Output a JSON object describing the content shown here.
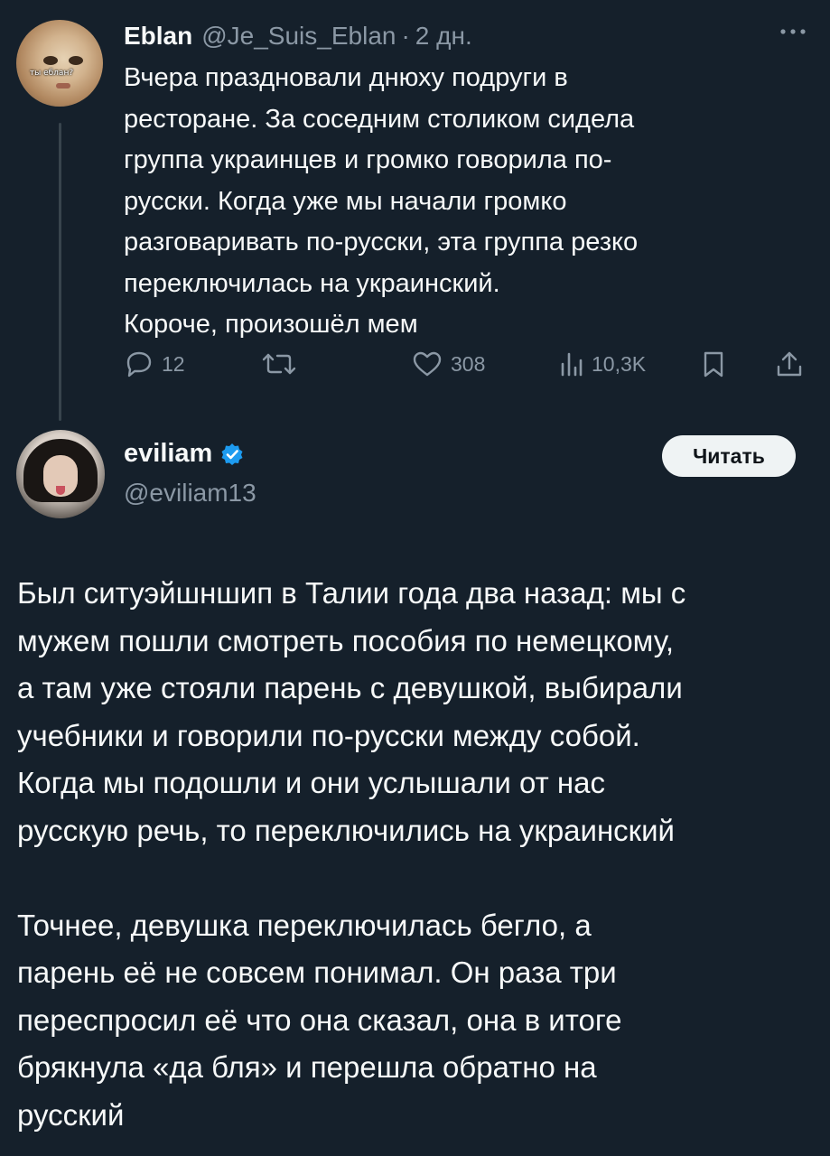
{
  "parent_tweet": {
    "author_name": "Eblan",
    "handle": "@Je_Suis_Eblan",
    "separator": "·",
    "time": "2 дн.",
    "avatar_caption": "ты еблан?",
    "text_lines": [
      "Вчера праздновали днюху подруги в",
      "ресторане. За соседним столиком сидела",
      "группа украинцев и громко говорила по-",
      "русски. Когда уже мы начали громко",
      "разговаривать по-русски, эта группа резко",
      "переключилась на украинский.",
      "Короче, произошёл мем"
    ],
    "actions": {
      "replies": "12",
      "likes": "308",
      "views": "10,3K"
    }
  },
  "quoted_tweet": {
    "author_name": "eviliam",
    "handle": "@eviliam13",
    "follow_label": "Читать",
    "verified_color": "#1d9bf0",
    "paragraph1_lines": [
      "Был ситуэйшншип в Талии года два назад: мы с",
      "мужем пошли смотреть пособия по немецкому,",
      "а там уже стояли парень с девушкой, выбирали",
      "учебники и говорили по-русски между собой.",
      "Когда мы подошли и они услышали от нас",
      "русскую речь, то переключились на украинский"
    ],
    "paragraph2_lines": [
      "Точнее, девушка переключилась бегло, а",
      "парень её не совсем понимал. Он раза три",
      "переспросил её что она сказал, она в итоге",
      "брякнула «да бля» и перешла обратно на",
      "русский"
    ]
  },
  "colors": {
    "background": "#15202b",
    "text": "#f7f9f9",
    "secondary": "#8b98a5",
    "thread_line": "#38444d"
  }
}
